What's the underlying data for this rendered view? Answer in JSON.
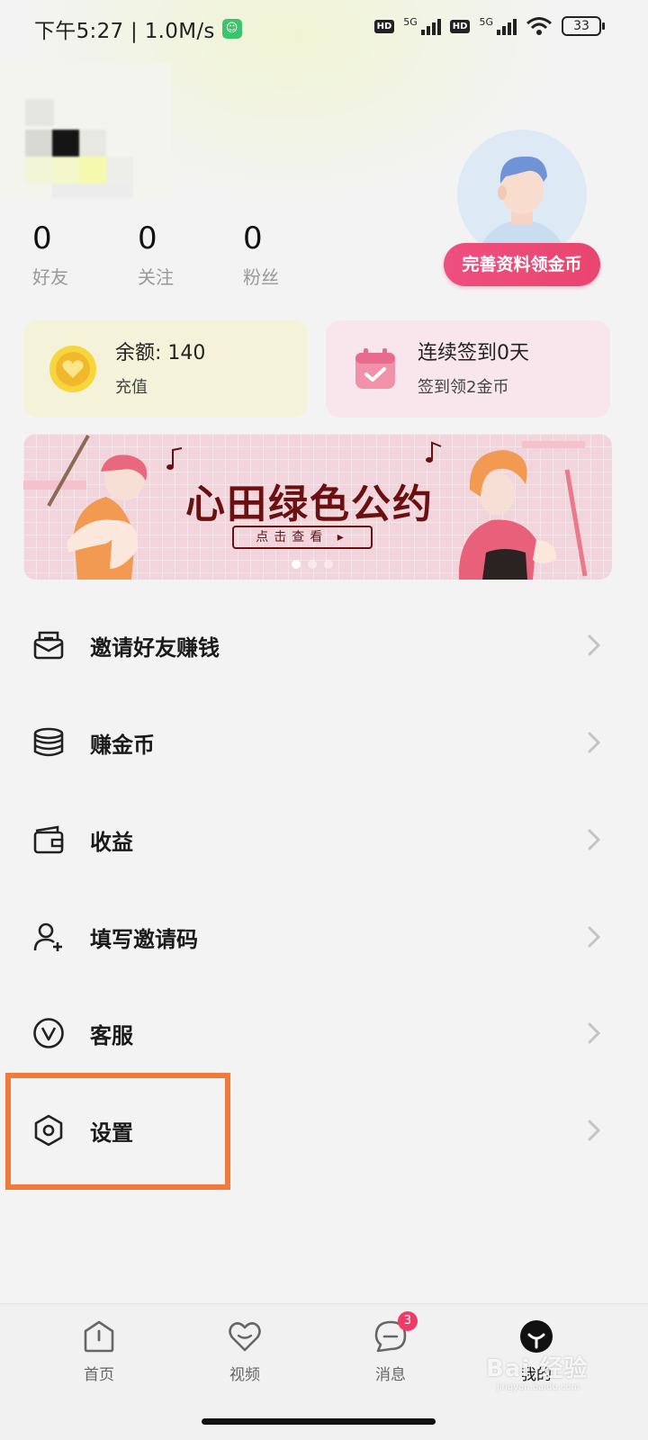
{
  "status_bar": {
    "time_speed": "下午5:27 | 1.0M/s",
    "network_type": "5G",
    "hd_label": "HD",
    "battery": "33"
  },
  "profile": {
    "stats": [
      {
        "value": "0",
        "label": "好友"
      },
      {
        "value": "0",
        "label": "关注"
      },
      {
        "value": "0",
        "label": "粉丝"
      }
    ],
    "complete_button": "完善资料领金币"
  },
  "cards": {
    "balance": {
      "title": "余额: 140",
      "subtitle": "充值",
      "icon": "coin-heart-icon"
    },
    "signin": {
      "title": "连续签到0天",
      "subtitle": "签到领2金币",
      "icon": "calendar-check-icon"
    }
  },
  "banner": {
    "title": "心田绿色公约",
    "button": "点击查看 ▸",
    "slide_count": 3,
    "active_slide": 0
  },
  "menu": [
    {
      "label": "邀请好友赚钱",
      "icon": "invite-envelope-icon"
    },
    {
      "label": "赚金币",
      "icon": "coin-stack-icon"
    },
    {
      "label": "收益",
      "icon": "wallet-icon"
    },
    {
      "label": "填写邀请码",
      "icon": "user-add-icon"
    },
    {
      "label": "客服",
      "icon": "customer-service-icon"
    },
    {
      "label": "设置",
      "icon": "settings-hexagon-icon"
    }
  ],
  "tabbar": [
    {
      "label": "首页",
      "icon": "home-icon"
    },
    {
      "label": "视频",
      "icon": "video-heart-icon"
    },
    {
      "label": "消息",
      "icon": "message-icon",
      "badge": "3"
    },
    {
      "label": "我的",
      "icon": "profile-icon",
      "active": true
    }
  ],
  "watermark": {
    "main": "Bai 经验",
    "sub": "jingyan.baidu.com"
  },
  "colors": {
    "accent": "#e8456f",
    "highlight": "#f07a3c",
    "banner_text": "#6b1010"
  }
}
